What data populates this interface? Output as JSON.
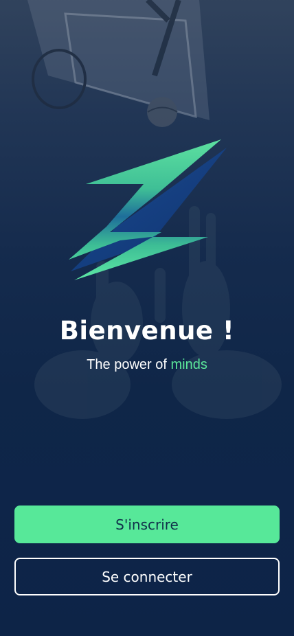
{
  "welcome": {
    "title": "Bienvenue !",
    "tagline_prefix": "The power of ",
    "tagline_accent": "minds"
  },
  "actions": {
    "signup_label": "S'inscrire",
    "login_label": "Se connecter"
  },
  "logo": {
    "icon": "lightning-z-logo"
  },
  "colors": {
    "background": "#0d2447",
    "accent": "#57e899",
    "text": "#ffffff"
  }
}
